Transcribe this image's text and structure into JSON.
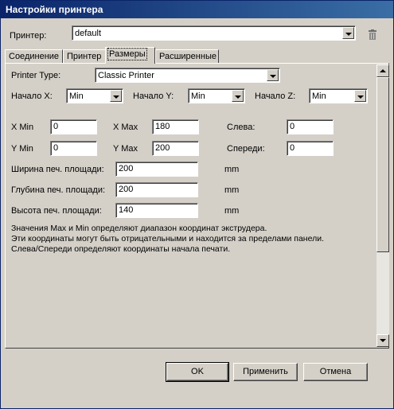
{
  "window": {
    "title": "Настройки принтера"
  },
  "printer": {
    "label": "Принтер:",
    "value": "default"
  },
  "tabs": [
    {
      "label": "Соединение"
    },
    {
      "label": "Принтер"
    },
    {
      "label": "Размеры"
    },
    {
      "label": "Расширенные"
    }
  ],
  "active_tab": "Размеры",
  "dimensions": {
    "printer_type_label": "Printer Type:",
    "printer_type_value": "Classic Printer",
    "origin_x_label": "Начало X:",
    "origin_x_value": "Min",
    "origin_y_label": "Начало Y:",
    "origin_y_value": "Min",
    "origin_z_label": "Начало Z:",
    "origin_z_value": "Min",
    "xmin_label": "X Min",
    "xmin_value": "0",
    "xmax_label": "X Max",
    "xmax_value": "180",
    "left_label": "Слева:",
    "left_value": "0",
    "ymin_label": "Y Min",
    "ymin_value": "0",
    "ymax_label": "Y Max",
    "ymax_value": "200",
    "front_label": "Спереди:",
    "front_value": "0",
    "bed_width_label": "Ширина печ. площади:",
    "bed_width_value": "200",
    "bed_depth_label": "Глубина печ. площади:",
    "bed_depth_value": "200",
    "bed_height_label": "Высота печ. площади:",
    "bed_height_value": "140",
    "unit": "mm",
    "help_line1": "Значения Max и Min определяют диапазон координат экструдера.",
    "help_line2": "Эти координаты могут быть отрицательными и находится за пределами панели.",
    "help_line3": "Слева/Спереди определяют координаты начала печати."
  },
  "buttons": {
    "ok": "OK",
    "apply": "Применить",
    "cancel": "Отмена"
  },
  "icons": {
    "delete": "trash-icon"
  }
}
